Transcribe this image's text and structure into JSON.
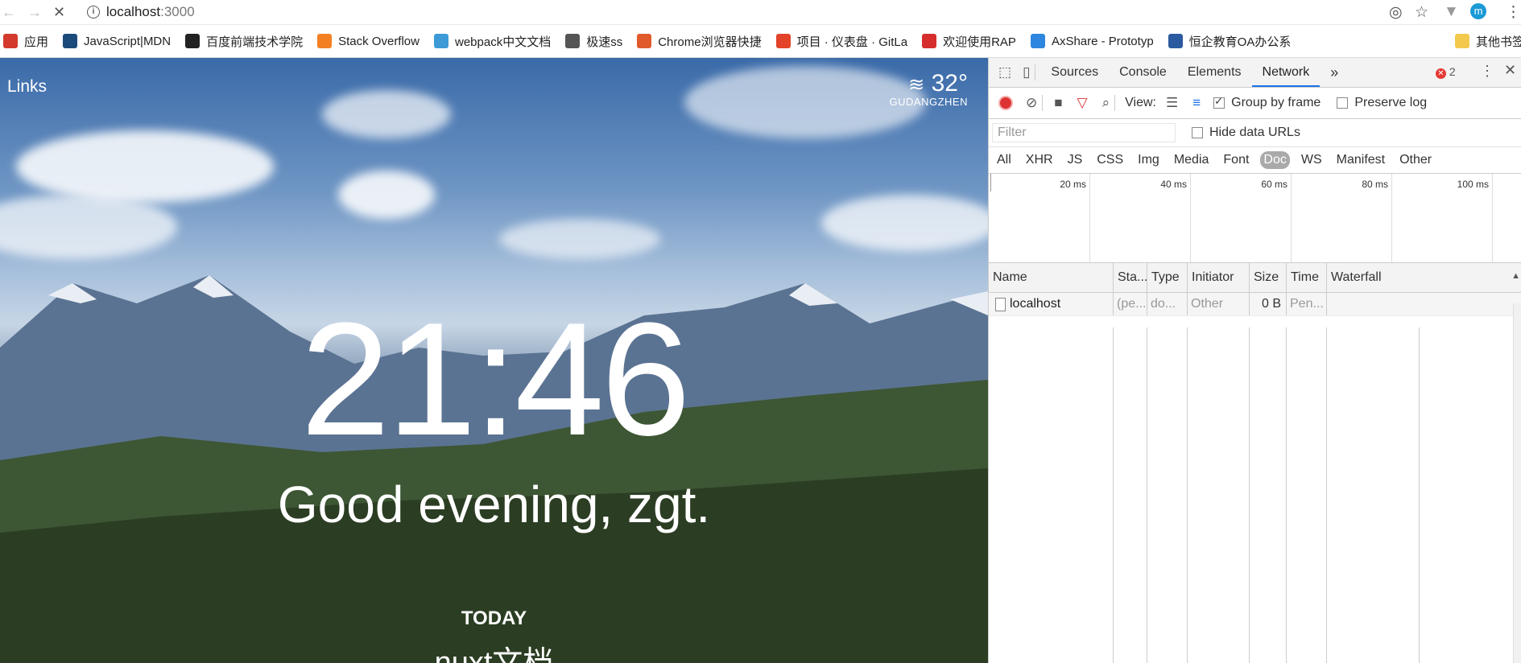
{
  "browser": {
    "url_host": "localhost",
    "url_port": ":3000",
    "bookmarks": [
      {
        "label": "应用",
        "icon": "apps-grid-icon",
        "color": "#d3392c"
      },
      {
        "label": "JavaScript|MDN",
        "icon": "mdn-icon",
        "color": "#1b4b7a"
      },
      {
        "label": "百度前端技术学院",
        "icon": "baidu-icon",
        "color": "#222222"
      },
      {
        "label": "Stack Overflow",
        "icon": "stackoverflow-icon",
        "color": "#f48024"
      },
      {
        "label": "webpack中文文档",
        "icon": "webpack-icon",
        "color": "#3c9ad6"
      },
      {
        "label": "极速ss",
        "icon": "paper-plane-icon",
        "color": "#555555"
      },
      {
        "label": "Chrome浏览器快捷",
        "icon": "jian-icon",
        "color": "#e05a2b"
      },
      {
        "label": "项目 · 仪表盘 · GitLa",
        "icon": "gitlab-icon",
        "color": "#e24329"
      },
      {
        "label": "欢迎使用RAP",
        "icon": "rap-icon",
        "color": "#d62d2d"
      },
      {
        "label": "AxShare - Prototyp",
        "icon": "cloud-icon",
        "color": "#2e86de"
      },
      {
        "label": "恒企教育OA办公系",
        "icon": "td-icon",
        "color": "#2c5aa0"
      },
      {
        "label": "其他书签",
        "icon": "folder-icon",
        "color": "#f2c94c"
      }
    ]
  },
  "page": {
    "links_label": "Links",
    "temperature": "32°",
    "location": "GUDANGZHEN",
    "clock": "21:46",
    "greeting": "Good evening, zgt.",
    "today_label": "TODAY",
    "today_focus": "nuxt文档"
  },
  "devtools": {
    "tabs": [
      "Sources",
      "Console",
      "Elements",
      "Network"
    ],
    "active_tab": "Network",
    "error_count": "2",
    "view_label": "View:",
    "group_by_frame": "Group by frame",
    "preserve_log": "Preserve log",
    "filter_placeholder": "Filter",
    "hide_data_urls": "Hide data URLs",
    "types": [
      "All",
      "XHR",
      "JS",
      "CSS",
      "Img",
      "Media",
      "Font",
      "Doc",
      "WS",
      "Manifest",
      "Other"
    ],
    "active_type": "Doc",
    "timeline_labels": [
      "20 ms",
      "40 ms",
      "60 ms",
      "80 ms",
      "100 ms"
    ],
    "columns": [
      "Name",
      "Sta...",
      "Type",
      "Initiator",
      "Size",
      "Time",
      "Waterfall"
    ],
    "rows": [
      {
        "name": "localhost",
        "status": "(pe...",
        "type": "do...",
        "initiator": "Other",
        "size": "0 B",
        "time": "Pen..."
      }
    ]
  }
}
